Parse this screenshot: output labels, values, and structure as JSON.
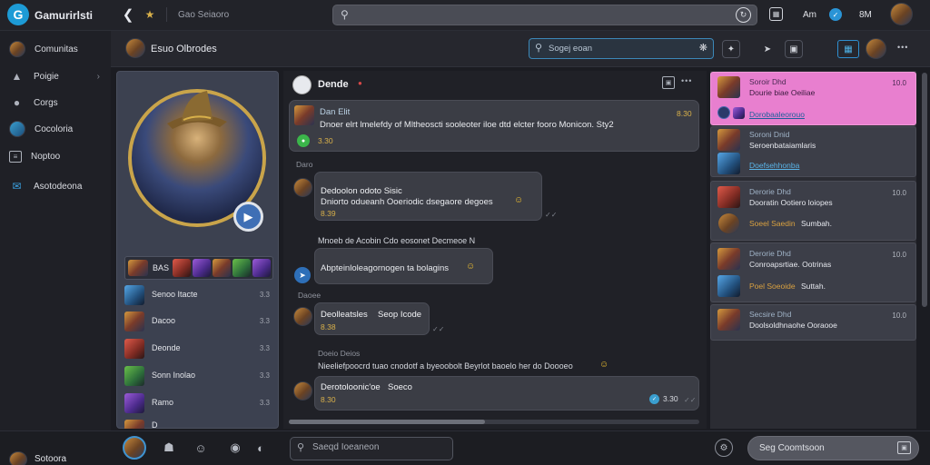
{
  "app": {
    "title": "Gamurirlsti",
    "breadcrumb": "Gao Seiaoro",
    "user_name": "Am",
    "level": "8M"
  },
  "colors": {
    "accent": "#1d9bd6",
    "highlight": "#e87fcf",
    "gold": "#d8b04a",
    "panel": "#3c4150"
  },
  "nav": {
    "items": [
      {
        "label": "Comunitas",
        "icon": "avatar-icon"
      },
      {
        "label": "Poigie",
        "icon": "gamepad-icon"
      },
      {
        "label": "Corgs",
        "icon": "users-icon"
      },
      {
        "label": "Cocoloria",
        "icon": "avatar-icon"
      },
      {
        "label": "Noptoo",
        "icon": "list-icon"
      },
      {
        "label": "Asotodeona",
        "icon": "chat-icon"
      }
    ],
    "footer_user": "Sotoora"
  },
  "room": {
    "title": "Esuo Olbrodes",
    "search_placeholder": "Sogej eoan"
  },
  "profile": {
    "team_label": "BAS",
    "members": [
      {
        "name": "Senoo Itacte",
        "value": "3.3"
      },
      {
        "name": "Dacoo",
        "value": "3.3"
      },
      {
        "name": "Deonde",
        "value": "3.3"
      },
      {
        "name": "Sonn Inolao",
        "value": "3.3"
      },
      {
        "name": "Ramo",
        "value": "3.3"
      },
      {
        "name": "D",
        "value": ""
      }
    ]
  },
  "chat": {
    "title": "Dende",
    "messages": [
      {
        "name": "Dan Elit",
        "text": "Dnoer elrt lmelefdy of Mltheoscti sooleoter iloe dtd elcter fooro Monicon. Sty2",
        "time": "8.30",
        "reactions": "3.30"
      },
      {
        "section": "Daro"
      },
      {
        "name": "Dedoolon odoto Sisic",
        "text": "Dniorto odueanh Ooeriodic dsegaore degoes",
        "time": "8.39"
      },
      {
        "section": "Mnoeb de Acobin Cdo eosonet Decmeoe N"
      },
      {
        "text": "Abpteinloleagornogen ta bolagins"
      },
      {
        "section": "Daoee"
      },
      {
        "name": "Deolleatsles",
        "tag": "Seop Icode",
        "time": "8.38"
      },
      {
        "section": "Doeio Deios"
      },
      {
        "section": "Nieeliefpoocrd tuao cnodotf a byeoobolt Beyrlot baoelo her do Doooeo"
      },
      {
        "name": "Derotoloonic'oe",
        "tag": "Soeco",
        "time": "8.30",
        "reactions": "3.30"
      }
    ]
  },
  "conversations": [
    {
      "name": "Soroir Dhd",
      "text": "Dourie biae Oeiliae",
      "time": "10.0"
    },
    {
      "name": "",
      "text": "Dorobaaleorouo",
      "time": ""
    },
    {
      "name": "Soroni Dnid",
      "text": "Seroenbataiamlaris",
      "time": ""
    },
    {
      "name": "",
      "text": "Doefsehhonba",
      "time": ""
    },
    {
      "name": "Derorie Dhd",
      "text": "Dooratin Ootiero loiopes",
      "time": "10.0"
    },
    {
      "name": "Soeel Saedin",
      "text": "Sumbah.",
      "time": ""
    },
    {
      "name": "Derorie Dhd",
      "text": "Conroapsrtiae. Ootrinas",
      "time": "10.0"
    },
    {
      "name": "Poel Soeoide",
      "text": "Suttah.",
      "time": ""
    },
    {
      "name": "Secsire Dhd",
      "text": "Doolsoldhnaohe Ooraooe",
      "time": "10.0"
    }
  ],
  "composer": {
    "placeholder": "Saeqd Ioeaneon",
    "send_label": "Seg Coomtsoon"
  }
}
